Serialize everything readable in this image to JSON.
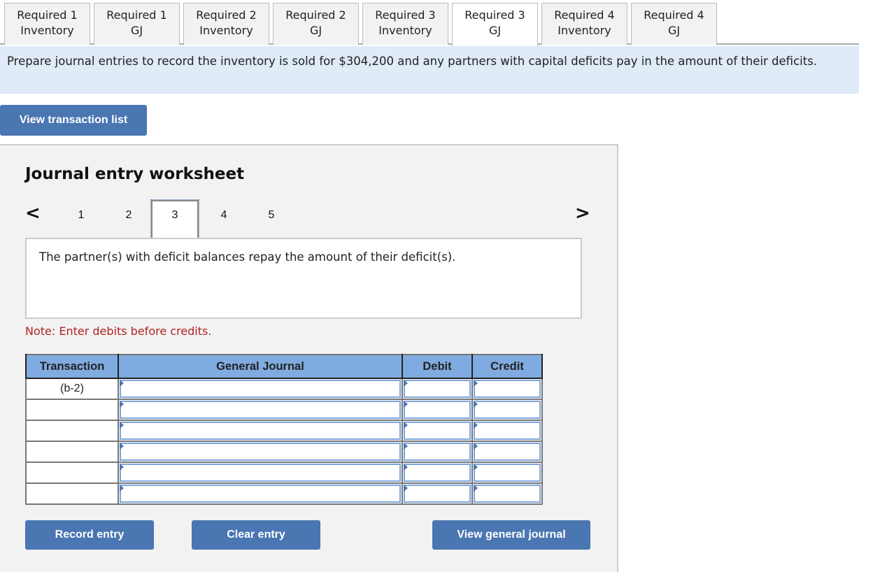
{
  "tabs": [
    {
      "line1": "Required 1",
      "line2": "Inventory",
      "active": false
    },
    {
      "line1": "Required 1",
      "line2": "GJ",
      "active": false
    },
    {
      "line1": "Required 2",
      "line2": "Inventory",
      "active": false
    },
    {
      "line1": "Required 2",
      "line2": "GJ",
      "active": false
    },
    {
      "line1": "Required 3",
      "line2": "Inventory",
      "active": false
    },
    {
      "line1": "Required 3",
      "line2": "GJ",
      "active": true
    },
    {
      "line1": "Required 4",
      "line2": "Inventory",
      "active": false
    },
    {
      "line1": "Required 4",
      "line2": "GJ",
      "active": false
    }
  ],
  "prompt": "Prepare journal entries to record the inventory is sold for $304,200 and any partners with capital deficits pay in the amount of their deficits.",
  "view_transaction_list_label": "View transaction list",
  "worksheet": {
    "title": "Journal entry worksheet",
    "prev_icon": "<",
    "next_icon": ">",
    "pages": [
      "1",
      "2",
      "3",
      "4",
      "5"
    ],
    "active_page": "3",
    "description": "The partner(s) with deficit balances repay the amount of their deficit(s).",
    "note": "Note: Enter debits before credits.",
    "columns": [
      "Transaction",
      "General Journal",
      "Debit",
      "Credit"
    ],
    "rows": [
      {
        "transaction": "(b-2)",
        "account": "",
        "debit": "",
        "credit": ""
      },
      {
        "transaction": "",
        "account": "",
        "debit": "",
        "credit": ""
      },
      {
        "transaction": "",
        "account": "",
        "debit": "",
        "credit": ""
      },
      {
        "transaction": "",
        "account": "",
        "debit": "",
        "credit": ""
      },
      {
        "transaction": "",
        "account": "",
        "debit": "",
        "credit": ""
      },
      {
        "transaction": "",
        "account": "",
        "debit": "",
        "credit": ""
      }
    ],
    "buttons": {
      "record": "Record entry",
      "clear": "Clear entry",
      "view_journal": "View general journal"
    }
  },
  "colors": {
    "accent": "#4a76b2",
    "header_bg": "#80abe0",
    "prompt_bg": "#dfebf7",
    "note": "#b22222"
  }
}
